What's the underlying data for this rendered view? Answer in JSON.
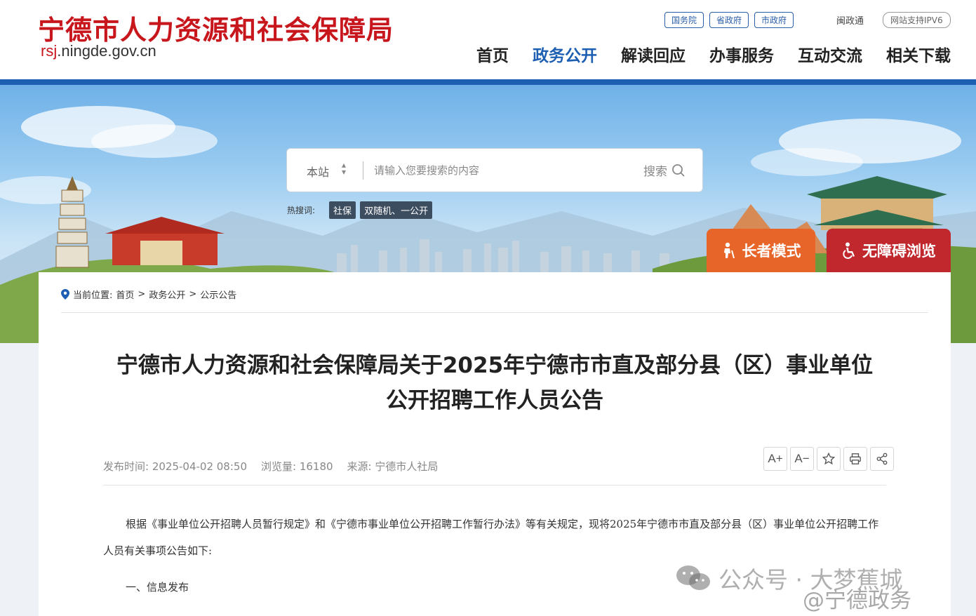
{
  "site": {
    "name": "宁德市人力资源和社会保障局",
    "url_red": "rsj",
    "url_rest": ".ningde.gov.cn"
  },
  "top_links": [
    "国务院",
    "省政府",
    "市政府"
  ],
  "minzt": "闽政通",
  "ipv6": "网站支持IPV6",
  "nav": {
    "items": [
      "首页",
      "政务公开",
      "解读回应",
      "办事服务",
      "互动交流",
      "相关下载"
    ],
    "active": "政务公开"
  },
  "search": {
    "scope": "本站",
    "placeholder": "请输入您要搜索的内容",
    "button": "搜索",
    "hot_label": "热搜词:",
    "hot_tags": [
      "社保",
      "双随机、一公开"
    ]
  },
  "modes": {
    "elder": "长者模式",
    "accessible": "无障碍浏览"
  },
  "breadcrumb": {
    "prefix": "当前位置:",
    "items": [
      "首页",
      "政务公开",
      "公示公告"
    ],
    "sep": ">"
  },
  "article": {
    "title_line1": "宁德市人力资源和社会保障局关于2025年宁德市市直及部分县（区）事业单位",
    "title_line2": "公开招聘工作人员公告",
    "publish_time": "发布时间: 2025-04-02 08:50",
    "views": "浏览量: 16180",
    "source": "来源: 宁德市人社局",
    "para1": "根据《事业单位公开招聘人员暂行规定》和《宁德市事业单位公开招聘工作暂行办法》等有关规定，现将2025年宁德市市直及部分县（区）事业单位公开招聘工作人员有关事项公告如下:",
    "section1": "一、信息发布"
  },
  "tools": {
    "font_up": "A+",
    "font_down": "A−"
  },
  "watermark": {
    "line1": "公众号 · 大梦蕉城",
    "line2": "@宁德政务"
  },
  "colors": {
    "brand_red": "#c8161d",
    "nav_blue": "#1d5fb2",
    "elder_orange": "#e8652a",
    "access_red": "#c0282e"
  }
}
